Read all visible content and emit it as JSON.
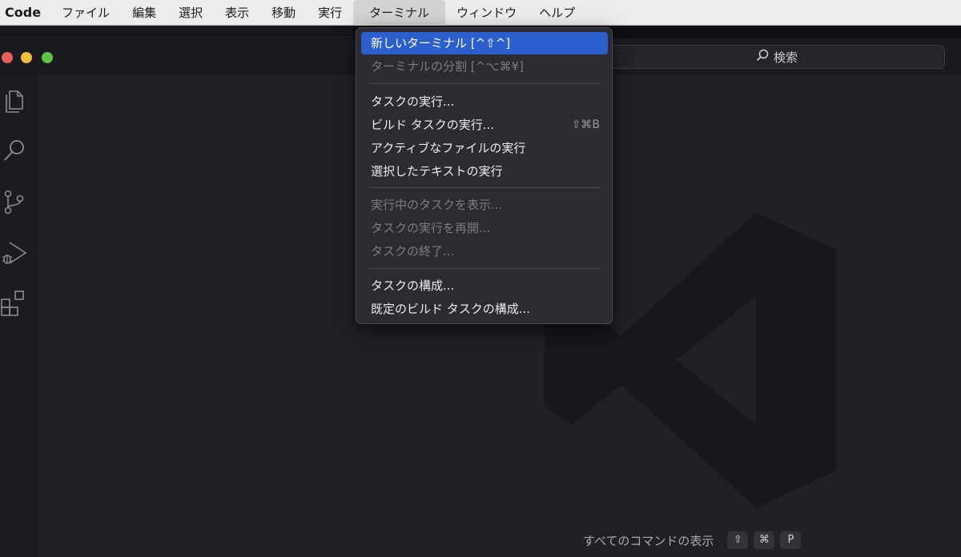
{
  "menubar": {
    "app_name": "Code",
    "items": [
      "ファイル",
      "編集",
      "選択",
      "表示",
      "移動",
      "実行",
      "ターミナル",
      "ウィンドウ",
      "ヘルプ"
    ],
    "active_item": "ターミナル"
  },
  "command_center": {
    "label": "検索",
    "icon": "search-icon"
  },
  "activity_bar": {
    "icons": [
      "explorer-icon",
      "search-icon",
      "source-control-icon",
      "run-debug-icon",
      "extensions-icon"
    ]
  },
  "terminal_menu": {
    "items": [
      {
        "label": "新しいターミナル [^⇧^]",
        "enabled": true,
        "highlighted": true
      },
      {
        "label": "ターミナルの分割 [^⌥⌘¥]",
        "enabled": false
      },
      {
        "label": "タスクの実行...",
        "enabled": true
      },
      {
        "label": "ビルド タスクの実行...",
        "enabled": true,
        "shortcut": "⇧⌘B"
      },
      {
        "label": "アクティブなファイルの実行",
        "enabled": true
      },
      {
        "label": "選択したテキストの実行",
        "enabled": true
      },
      {
        "label": "実行中のタスクを表示...",
        "enabled": false
      },
      {
        "label": "タスクの実行を再開...",
        "enabled": false
      },
      {
        "label": "タスクの終了...",
        "enabled": false
      },
      {
        "label": "タスクの構成...",
        "enabled": true
      },
      {
        "label": "既定のビルド タスクの構成...",
        "enabled": true
      }
    ]
  },
  "editor": {
    "hint_label": "すべてのコマンドの表示",
    "hint_keys": [
      "⇧",
      "⌘",
      "P"
    ]
  },
  "colors": {
    "menu_highlight": "#2c5fce",
    "editor_background": "#1f2127"
  }
}
